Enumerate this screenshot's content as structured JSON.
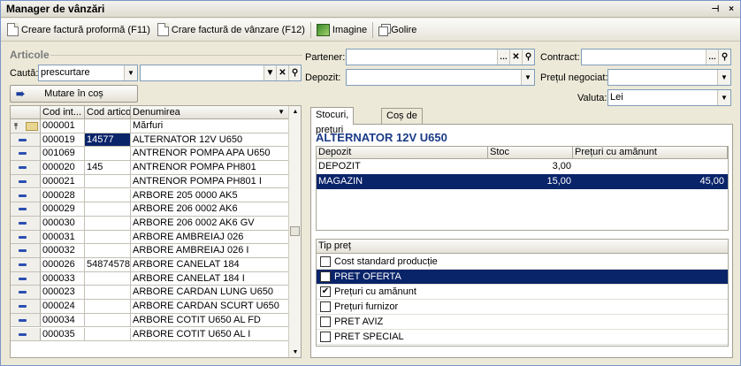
{
  "window": {
    "title": "Manager de vânzări",
    "pin": "⊣",
    "close": "×"
  },
  "toolbar": {
    "proforma": "Creare factură proformă (F11)",
    "invoice": "Crare factură de vânzare (F12)",
    "image": "Imagine",
    "clear": "Golire"
  },
  "articles": {
    "section_title": "Articole",
    "search_label": "Caută:",
    "search_field": "prescurtare",
    "search_value": "",
    "move_button": "Mutare în coș",
    "columns": [
      "Cod int...",
      "Cod articol",
      "Denumirea"
    ],
    "rows": [
      {
        "code": "000001",
        "art": "",
        "name": "Mărfuri",
        "folder": true
      },
      {
        "code": "000019",
        "art": "14577",
        "name": "ALTERNATOR 12V U650",
        "selected": true
      },
      {
        "code": "001069",
        "art": "",
        "name": "ANTRENOR POMPA APA U650"
      },
      {
        "code": "000020",
        "art": "145",
        "name": "ANTRENOR POMPA PH801"
      },
      {
        "code": "000021",
        "art": "",
        "name": "ANTRENOR POMPA PH801 I"
      },
      {
        "code": "000028",
        "art": "",
        "name": "ARBORE 205 0000 AK5"
      },
      {
        "code": "000029",
        "art": "",
        "name": "ARBORE 206 0002 AK6"
      },
      {
        "code": "000030",
        "art": "",
        "name": "ARBORE 206 0002 AK6 GV"
      },
      {
        "code": "000031",
        "art": "",
        "name": "ARBORE AMBREIAJ 026"
      },
      {
        "code": "000032",
        "art": "",
        "name": "ARBORE AMBREIAJ 026 I"
      },
      {
        "code": "000026",
        "art": "54874578",
        "name": "ARBORE CANELAT 184"
      },
      {
        "code": "000033",
        "art": "",
        "name": "ARBORE CANELAT 184 I"
      },
      {
        "code": "000023",
        "art": "",
        "name": "ARBORE CARDAN LUNG U650"
      },
      {
        "code": "000024",
        "art": "",
        "name": "ARBORE CARDAN SCURT U650"
      },
      {
        "code": "000034",
        "art": "",
        "name": "ARBORE COTIT U650 AL FD"
      },
      {
        "code": "000035",
        "art": "",
        "name": "ARBORE COTIT U650 AL I"
      }
    ]
  },
  "filters": {
    "partner_label": "Partener:",
    "partner_value": "",
    "contract_label": "Contract:",
    "contract_value": "",
    "depot_label": "Depozit:",
    "depot_value": "",
    "price_label": "Prețul negociat:",
    "price_value": "",
    "currency_label": "Valuta:",
    "currency_value": "Lei"
  },
  "tabs": [
    "Stocuri, prețuri",
    "Coș de articole"
  ],
  "product": {
    "title": "ALTERNATOR 12V U650",
    "stock_columns": [
      "Depozit",
      "Stoc",
      "Prețuri cu amănunt"
    ],
    "stock_rows": [
      {
        "depot": "DEPOZIT",
        "stock": "3,00",
        "price": ""
      },
      {
        "depot": "MAGAZIN",
        "stock": "15,00",
        "price": "45,00",
        "selected": true
      }
    ],
    "price_type_header": "Tip preț",
    "price_types": [
      {
        "label": "Cost standard producție",
        "checked": false
      },
      {
        "label": "PRET OFERTA",
        "checked": false,
        "selected": true
      },
      {
        "label": "Prețuri cu amănunt",
        "checked": true
      },
      {
        "label": "Prețuri furnizor",
        "checked": false
      },
      {
        "label": "PRET AVIZ",
        "checked": false
      },
      {
        "label": "PRET SPECIAL",
        "checked": false
      }
    ]
  }
}
